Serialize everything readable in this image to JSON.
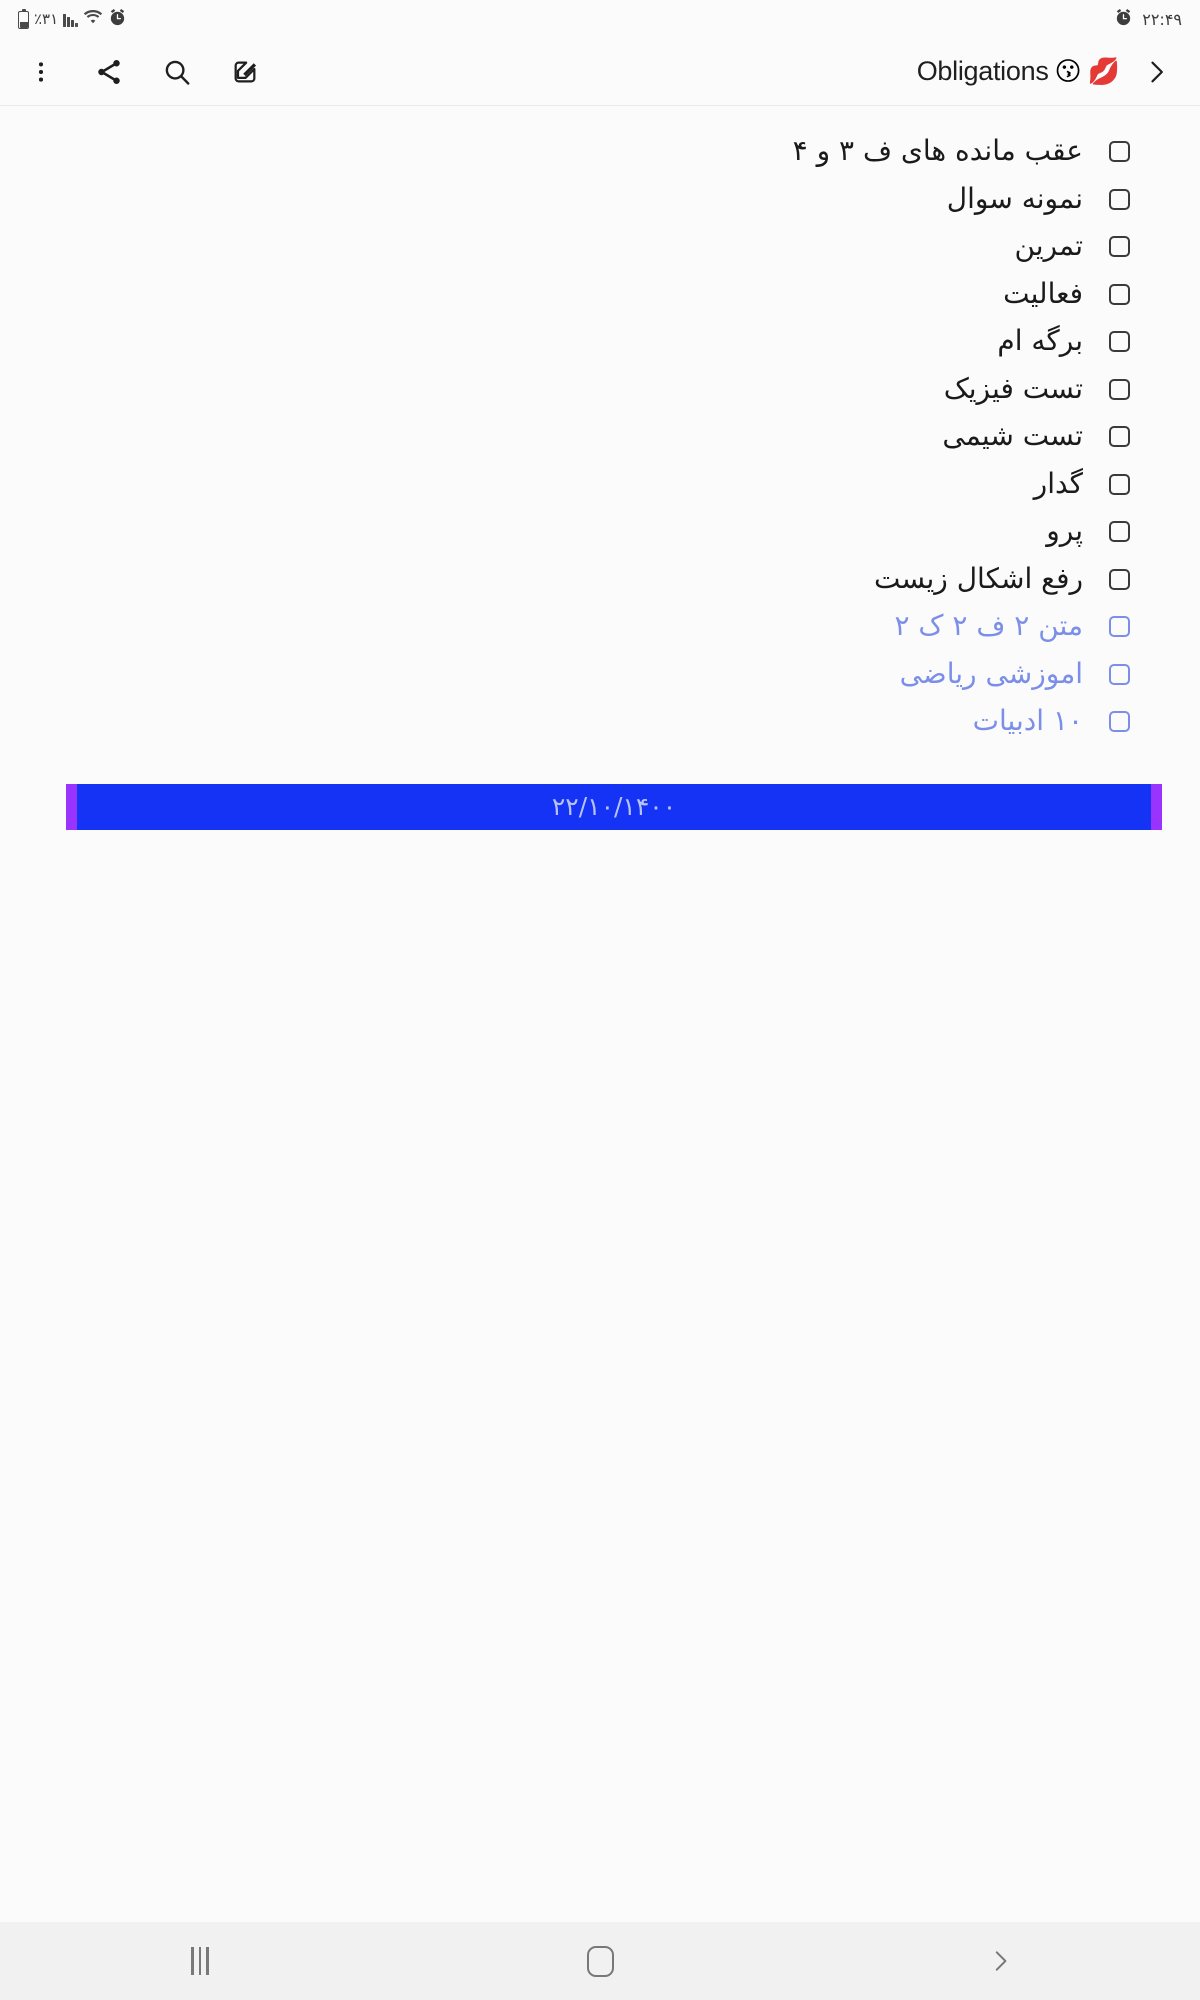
{
  "status_bar": {
    "battery_icon": "battery-icon",
    "battery_percent": "٪۳۱",
    "signal_icon": "cell-signal-icon",
    "wifi_icon": "wifi-icon",
    "alarm_icon": "alarm-clock-icon",
    "time": "۲۲:۴۹"
  },
  "toolbar": {
    "more_icon": "more-vertical-icon",
    "share_icon": "share-icon",
    "search_icon": "search-icon",
    "compose_icon": "compose-edit-icon",
    "title": "Obligations",
    "title_emoji_1": "😗",
    "title_emoji_2": "💋",
    "forward_icon": "chevron-right-icon"
  },
  "note": {
    "items": [
      {
        "label": "عقب مانده های ف ۳ و ۴",
        "checked": false,
        "color": "dark"
      },
      {
        "label": "نمونه سوال",
        "checked": false,
        "color": "dark"
      },
      {
        "label": "تمرین",
        "checked": false,
        "color": "dark"
      },
      {
        "label": "فعالیت",
        "checked": false,
        "color": "dark"
      },
      {
        "label": "برگه ام",
        "checked": false,
        "color": "dark"
      },
      {
        "label": "تست فیزیک",
        "checked": false,
        "color": "dark"
      },
      {
        "label": "تست شیمی",
        "checked": false,
        "color": "dark"
      },
      {
        "label": "گدار",
        "checked": false,
        "color": "dark"
      },
      {
        "label": "پرو",
        "checked": false,
        "color": "dark"
      },
      {
        "label": "رفع اشکال زیست",
        "checked": false,
        "color": "dark"
      },
      {
        "label": "متن ۲ ف ۲ ک ۲",
        "checked": false,
        "color": "blue"
      },
      {
        "label": "اموزشی ریاضی",
        "checked": false,
        "color": "blue"
      },
      {
        "label": "۱۰ ادبیات",
        "checked": false,
        "color": "blue"
      }
    ],
    "selection": {
      "text": "۲۲/۱۰/۱۴۰۰",
      "fill_color": "#1433F5",
      "handle_color": "#9933FF",
      "text_color": "#B9C2F7"
    },
    "blue_text_color": "#7B8FE8"
  },
  "nav_bar": {
    "recents_icon": "recents-icon",
    "home_icon": "home-icon",
    "back_icon": "back-chevron-icon"
  }
}
